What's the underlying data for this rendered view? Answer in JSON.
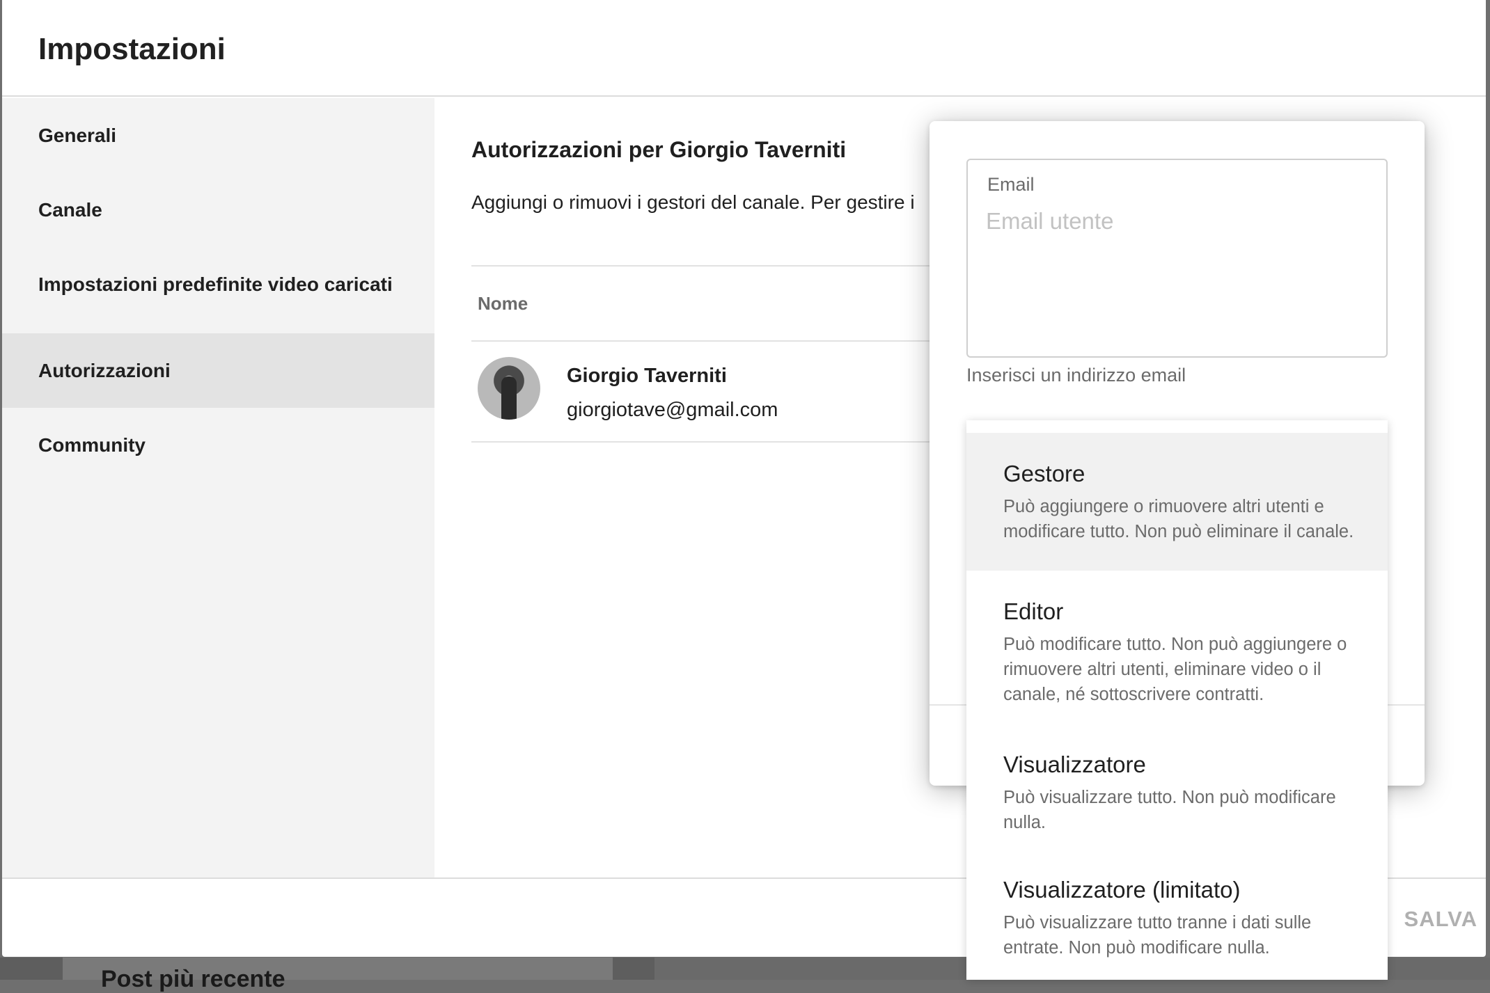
{
  "dialog": {
    "title": "Impostazioni",
    "save_label": "SALVA"
  },
  "sidebar": {
    "items": [
      {
        "label": "Generali"
      },
      {
        "label": "Canale"
      },
      {
        "label": "Impostazioni predefinite video caricati"
      },
      {
        "label": "Autorizzazioni",
        "active": true
      },
      {
        "label": "Community"
      }
    ]
  },
  "permissions": {
    "title": "Autorizzazioni per Giorgio Taverniti",
    "description": "Aggiungi o rimuovi i gestori del canale. Per gestire i",
    "column_name": "Nome",
    "users": [
      {
        "name": "Giorgio Taverniti",
        "email": "giorgiotave@gmail.com"
      }
    ]
  },
  "invite": {
    "email_label": "Email",
    "email_placeholder": "Email utente",
    "email_value": "",
    "email_help": "Inserisci un indirizzo email"
  },
  "roles": [
    {
      "name": "Gestore",
      "description": "Può aggiungere o rimuovere altri utenti e modificare tutto. Non può eliminare il canale.",
      "highlighted": true
    },
    {
      "name": "Editor",
      "description": "Può modificare tutto. Non può aggiungere o rimuovere altri utenti, eliminare video o il canale, né sottoscrivere contratti."
    },
    {
      "name": "Visualizzatore",
      "description": "Può visualizzare tutto. Non può modificare nulla."
    },
    {
      "name": "Visualizzatore (limitato)",
      "description": "Può visualizzare tutto tranne i dati sulle entrate. Non può modificare nulla."
    }
  ],
  "background": {
    "card_title": "Post più recente"
  }
}
